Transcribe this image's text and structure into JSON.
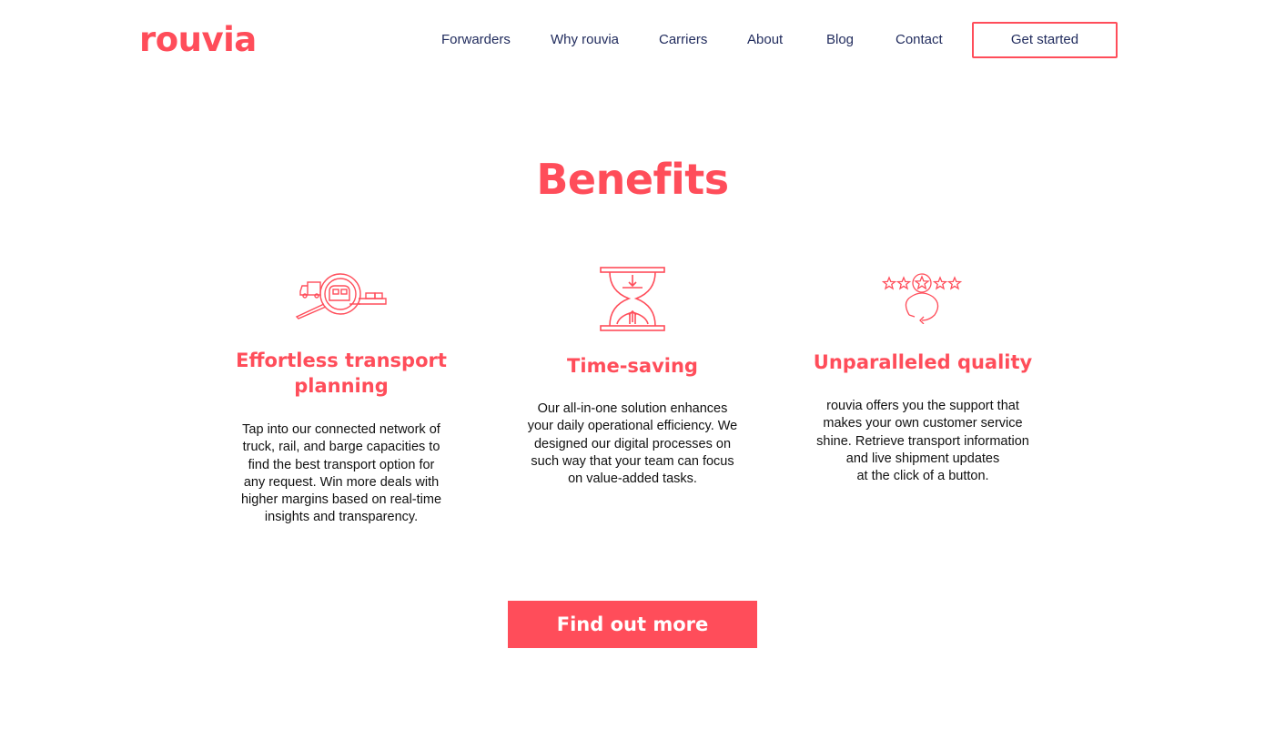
{
  "brand": {
    "name": "rouvia",
    "accent": "#ff4d5a",
    "nav_color": "#1f2a5c"
  },
  "nav": {
    "items": [
      "Forwarders",
      "Why rouvia",
      "Carriers",
      "About",
      "Blog",
      "Contact"
    ],
    "cta_label": "Get started"
  },
  "benefits": {
    "title": "Benefits",
    "items": [
      {
        "icon": "magnifier-transport-icon",
        "title_lines": [
          "Effortless transport",
          "planning"
        ],
        "text_lines": [
          "Tap into our connected network of",
          "truck, rail, and barge capacities to",
          "find the best transport option for",
          "any request. Win more deals with",
          "higher margins based on real-time",
          "insights and transparency."
        ]
      },
      {
        "icon": "hourglass-icon",
        "title_lines": [
          "Time-saving"
        ],
        "text_lines": [
          "Our all-in-one solution enhances",
          "your daily operational efficiency. We",
          "designed our digital processes on",
          "such way that your team can focus",
          "on value-added tasks."
        ]
      },
      {
        "icon": "star-rating-support-icon",
        "title_lines": [
          "Unparalleled quality"
        ],
        "text_lines": [
          "rouvia offers you the support that",
          "makes your own customer service",
          "shine. Retrieve transport information",
          "and live shipment updates",
          "at the click of a button."
        ]
      }
    ],
    "cta_label": "Find out more"
  }
}
